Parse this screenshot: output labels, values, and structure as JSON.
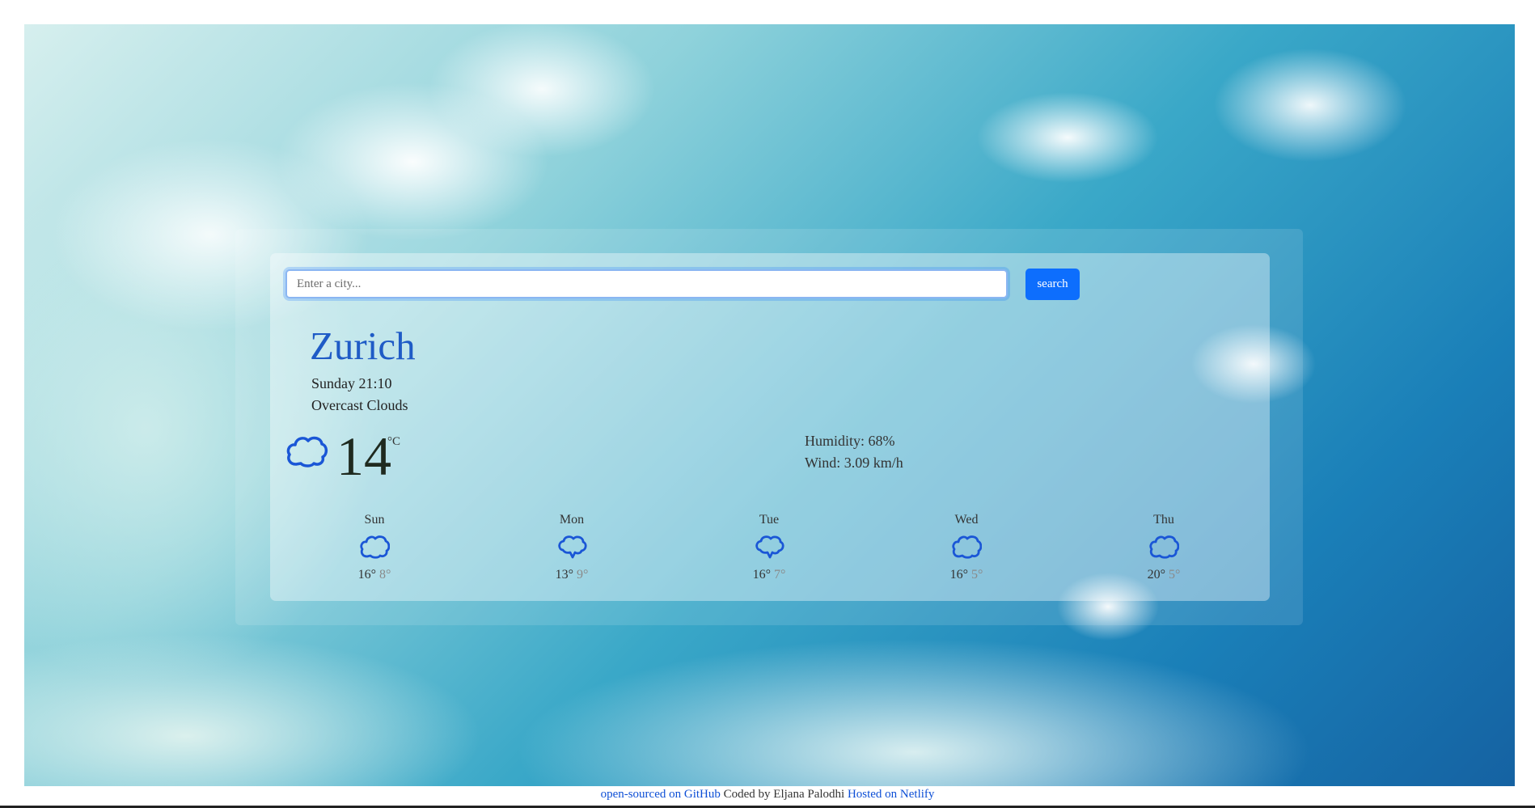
{
  "search": {
    "placeholder": "Enter a city...",
    "button_label": "search"
  },
  "current": {
    "city": "Zurich",
    "date_time": "Sunday 21:10",
    "description": "Overcast Clouds",
    "temperature": "14",
    "unit": "°C",
    "icon": "cloud-icon",
    "humidity_label": "Humidity:",
    "humidity_value": "68%",
    "wind_label": "Wind:",
    "wind_value": "3.09 km/h"
  },
  "forecast": [
    {
      "day": "Sun",
      "max": "16°",
      "min": "8°",
      "icon": "cloud-icon"
    },
    {
      "day": "Mon",
      "max": "13°",
      "min": "9°",
      "icon": "cloud-icon"
    },
    {
      "day": "Tue",
      "max": "16°",
      "min": "7°",
      "icon": "cloud-icon"
    },
    {
      "day": "Wed",
      "max": "16°",
      "min": "5°",
      "icon": "cloud-icon"
    },
    {
      "day": "Thu",
      "max": "20°",
      "min": "5°",
      "icon": "cloud-icon"
    }
  ],
  "footer": {
    "github_link": "open-sourced on GitHub",
    "coded_by": "Coded by Eljana Palodhi",
    "netlify_link": "Hosted on Netlify"
  },
  "colors": {
    "accent": "#0d6efd",
    "city": "#1f5bc6",
    "icon": "#1a56d6"
  }
}
